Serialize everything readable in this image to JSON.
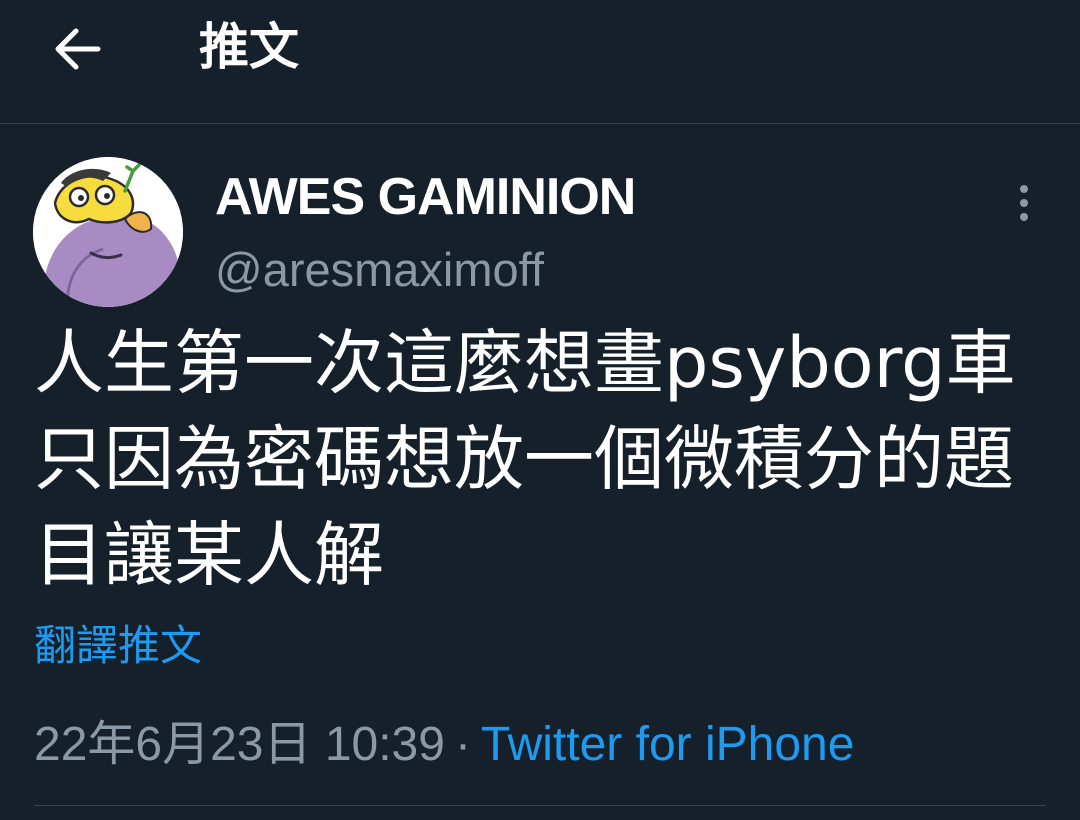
{
  "header": {
    "back_icon": "arrow-left-icon",
    "title": "推文"
  },
  "tweet": {
    "author": {
      "display_name": "AWES GAMINION",
      "handle": "@aresmaximoff",
      "avatar_icon": "cartoon-avatar"
    },
    "more_icon": "vertical-ellipsis-icon",
    "text": "人生第一次這麼想畫psyborg車只因為密碼想放一個微積分的題目讓某人解",
    "translate_label": "翻譯推文",
    "timestamp": "22年6月23日 10:39",
    "separator": "·",
    "source": "Twitter for iPhone"
  },
  "colors": {
    "background": "#15202b",
    "divider": "#38444d",
    "secondary_text": "#8b98a5",
    "accent": "#1d9bf0"
  }
}
